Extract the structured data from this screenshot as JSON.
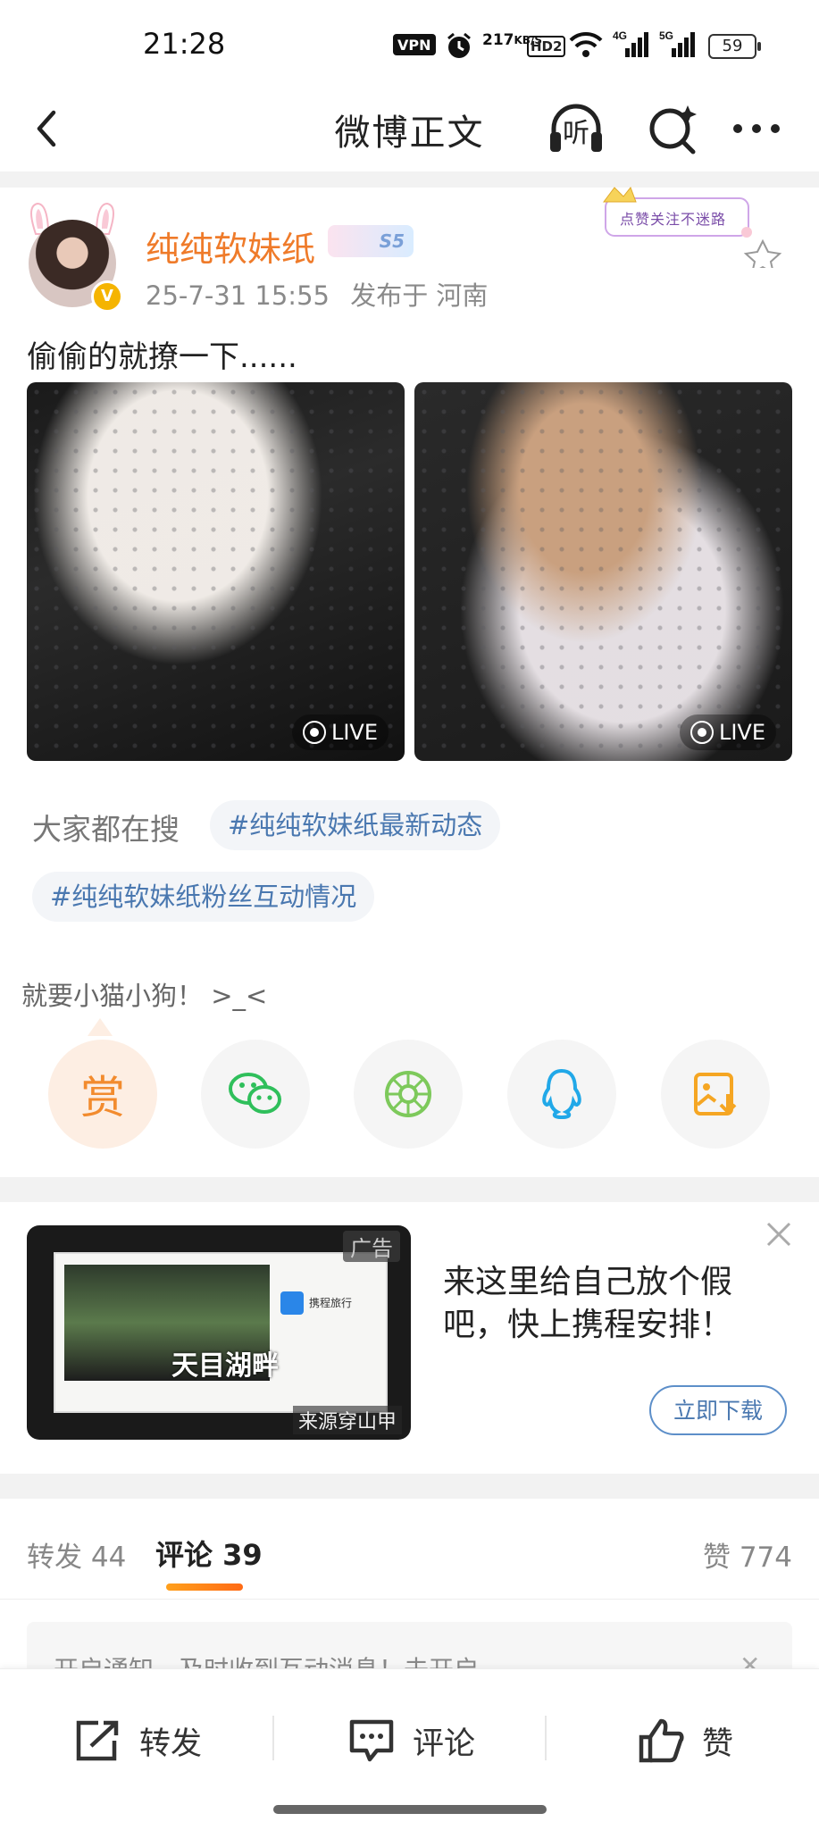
{
  "status_bar": {
    "time": "21:28",
    "vpn": "VPN",
    "speed_value": "217",
    "speed_unit": "KB/S",
    "hd": "HD2",
    "net1": "4G",
    "net2": "5G",
    "battery": "59"
  },
  "header": {
    "title": "微博正文",
    "listen_label": "听"
  },
  "post": {
    "user_name": "纯纯软妹纸",
    "user_tag": "S5",
    "time": "25-7-31 15:55",
    "location": "发布于 河南",
    "text": "偷偷的就撩一下......",
    "sticker_text": "点赞关注不迷路",
    "photos": [
      {
        "live_label": "LIVE"
      },
      {
        "live_label": "LIVE"
      }
    ]
  },
  "search_section": {
    "label": "大家都在搜",
    "topics": [
      "#纯纯软妹纸最新动态",
      "#纯纯软妹纸粉丝互动情况"
    ]
  },
  "reward": {
    "message": "就要小猫小狗！ >_<",
    "reward_label": "赏"
  },
  "ad": {
    "text": "来这里给自己放个假吧，快上携程安排！",
    "download_button": "立即下载",
    "ad_label": "广告",
    "source": "来源穿山甲",
    "image_caption": "天目湖畔",
    "brand": "携程旅行"
  },
  "tabs": {
    "repost": "转发 44",
    "comment": "评论 39",
    "likes": "赞 774"
  },
  "notification": {
    "text": "开启通知，及时收到互动消息！去开启"
  },
  "bottom_bar": {
    "repost": "转发",
    "comment": "评论",
    "like": "赞"
  },
  "colors": {
    "accent_orange": "#ef7b2a",
    "topic_blue": "#4a78b0",
    "wechat_green": "#2fbf5b",
    "moments_green": "#7dc95b",
    "qq_blue": "#21a8e8",
    "save_orange": "#f5a623"
  }
}
